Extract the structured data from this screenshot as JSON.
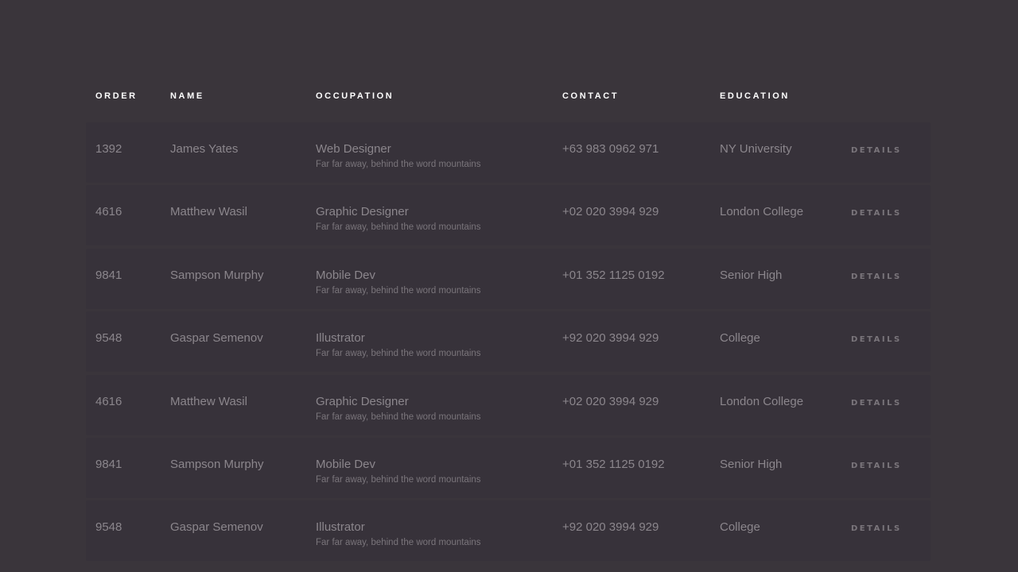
{
  "table": {
    "headers": {
      "order": "ORDER",
      "name": "NAME",
      "occupation": "OCCUPATION",
      "contact": "CONTACT",
      "education": "EDUCATION"
    },
    "rows": [
      {
        "order": "1392",
        "name": "James Yates",
        "occupation": "Web Designer",
        "description": "Far far away, behind the word mountains",
        "contact": "+63 983 0962 971",
        "education": "NY University",
        "action": "DETAILS"
      },
      {
        "order": "4616",
        "name": "Matthew Wasil",
        "occupation": "Graphic Designer",
        "description": "Far far away, behind the word mountains",
        "contact": "+02 020 3994 929",
        "education": "London College",
        "action": "DETAILS"
      },
      {
        "order": "9841",
        "name": "Sampson Murphy",
        "occupation": "Mobile Dev",
        "description": "Far far away, behind the word mountains",
        "contact": "+01 352 1125 0192",
        "education": "Senior High",
        "action": "DETAILS"
      },
      {
        "order": "9548",
        "name": "Gaspar Semenov",
        "occupation": "Illustrator",
        "description": "Far far away, behind the word mountains",
        "contact": "+92 020 3994 929",
        "education": "College",
        "action": "DETAILS"
      },
      {
        "order": "4616",
        "name": "Matthew Wasil",
        "occupation": "Graphic Designer",
        "description": "Far far away, behind the word mountains",
        "contact": "+02 020 3994 929",
        "education": "London College",
        "action": "DETAILS"
      },
      {
        "order": "9841",
        "name": "Sampson Murphy",
        "occupation": "Mobile Dev",
        "description": "Far far away, behind the word mountains",
        "contact": "+01 352 1125 0192",
        "education": "Senior High",
        "action": "DETAILS"
      },
      {
        "order": "9548",
        "name": "Gaspar Semenov",
        "occupation": "Illustrator",
        "description": "Far far away, behind the word mountains",
        "contact": "+92 020 3994 929",
        "education": "College",
        "action": "DETAILS"
      }
    ]
  },
  "colors": {
    "background": "#3a353b",
    "row_background": "#37323a",
    "header_text": "#ffffff",
    "body_text": "#8b868c",
    "muted_text": "#7a757b"
  }
}
